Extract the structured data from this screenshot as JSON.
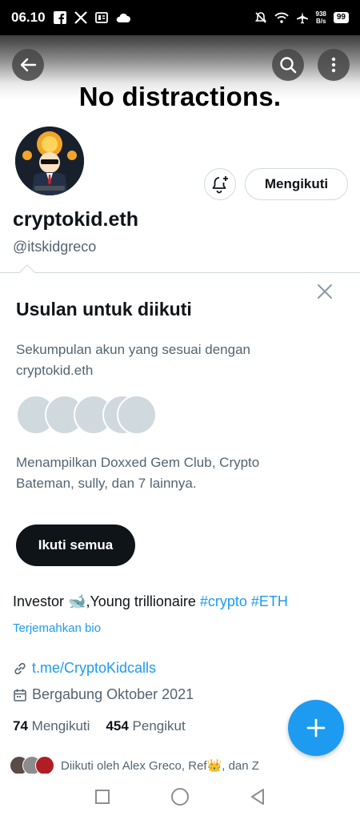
{
  "status_bar": {
    "time": "06.10",
    "network_speed_value": "938",
    "network_speed_unit": "B/s",
    "battery": "99",
    "icons": [
      "facebook-icon",
      "x-icon",
      "news-icon",
      "cloud-icon",
      "mute-icon",
      "wifi-icon",
      "airplane-icon"
    ]
  },
  "header": {
    "banner_text": "No distractions."
  },
  "profile": {
    "display_name": "cryptokid.eth",
    "handle": "@itskidgreco",
    "follow_button_label": "Mengikuti",
    "bio_text": "Investor 🐋,Young trillionaire ",
    "bio_tags": [
      "#crypto",
      "#ETH"
    ],
    "translate_label": "Terjemahkan bio",
    "link": "t.me/CryptoKidcalls",
    "joined": "Bergabung Oktober 2021",
    "following_count": "74",
    "following_label": "Mengikuti",
    "followers_count": "454",
    "followers_label": "Pengikut",
    "followed_by": "Diikuti oleh Alex Greco, Ref👑, dan Z"
  },
  "suggestions": {
    "title": "Usulan untuk diikuti",
    "description": "Sekumpulan akun yang sesuai dengan cryptokid.eth",
    "showing": "Menampilkan Doxxed Gem Club, Crypto Bateman, sully, dan 7 lainnya.",
    "follow_all_label": "Ikuti semua"
  },
  "colors": {
    "accent": "#1d9bf0",
    "text_primary": "#0f1419",
    "text_secondary": "#536471",
    "border": "#cfd9de",
    "avatar_placeholder": "#cfd9de"
  }
}
